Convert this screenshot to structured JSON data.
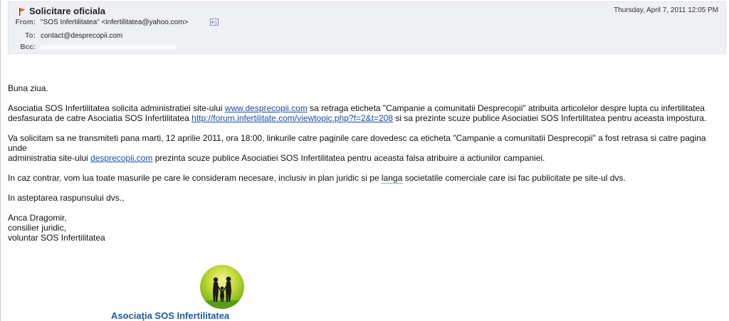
{
  "email": {
    "subject": "Solicitare oficiala",
    "date": "Thursday, April 7, 2011 12:05 PM",
    "from_label": "From:",
    "from_value": "\"SOS Infertilitatea\" <infertilitatea@yahoo.com>",
    "to_label": "To:",
    "to_value": "contact@desprecopii.com",
    "bcc_label": "Bcc:"
  },
  "body": {
    "greeting": "Buna ziua.",
    "p1_a": "Asociatia SOS Infertilitatea solicita administratiei site-ului ",
    "p1_link1": "www.desprecopii.com",
    "p1_b": " sa retraga eticheta \"Campanie a comunitatii Desprecopii\" atribuita articolelor despre lupta cu infertilitatea",
    "p1_c": "desfasurata de catre Asociatia SOS Infertilitatea ",
    "p1_link2": "http://forum.infertilitate.com/viewtopic.php?f=2&t=208",
    "p1_d": " si sa prezinte scuze publice Asociatiei SOS Infertilitatea pentru aceasta impostura.",
    "p2_a": "Va solicitam sa ne transmiteti pana marti, 12 aprilie 2011, ora 18:00, linkurile catre paginile care dovedesc ca eticheta \"Campanie a comunitatii Desprecopii\" a fost retrasa si catre pagina unde",
    "p2_b": "administratia site-ului ",
    "p2_link": "desprecopii.com",
    "p2_c": " prezinta scuze publice Asociatiei SOS Infertilitatea pentru aceasta falsa atribuire a actiunilor campaniei.",
    "p3_a": "In caz contrar, vom lua toate masurile pe care le consideram necesare, inclusiv in plan juridic si pe ",
    "p3_spell": "langa",
    "p3_b": " societatile comerciale care isi fac publicitate pe site-ul dvs.",
    "p4": "In asteptarea raspunsului dvs.,",
    "sig_name": "Anca Dragomir,",
    "sig_role": "consilier juridic,",
    "sig_org": "voluntar SOS Infertilitatea"
  },
  "logo": {
    "text": "Asociaţia SOS Infertilitatea",
    "icon": "family-silhouette-icon"
  },
  "colors": {
    "link": "#1f4fa0",
    "header_bg": "#eef0f4",
    "logo_text": "#1e5a9c",
    "logo_green": "#8bc21f"
  }
}
